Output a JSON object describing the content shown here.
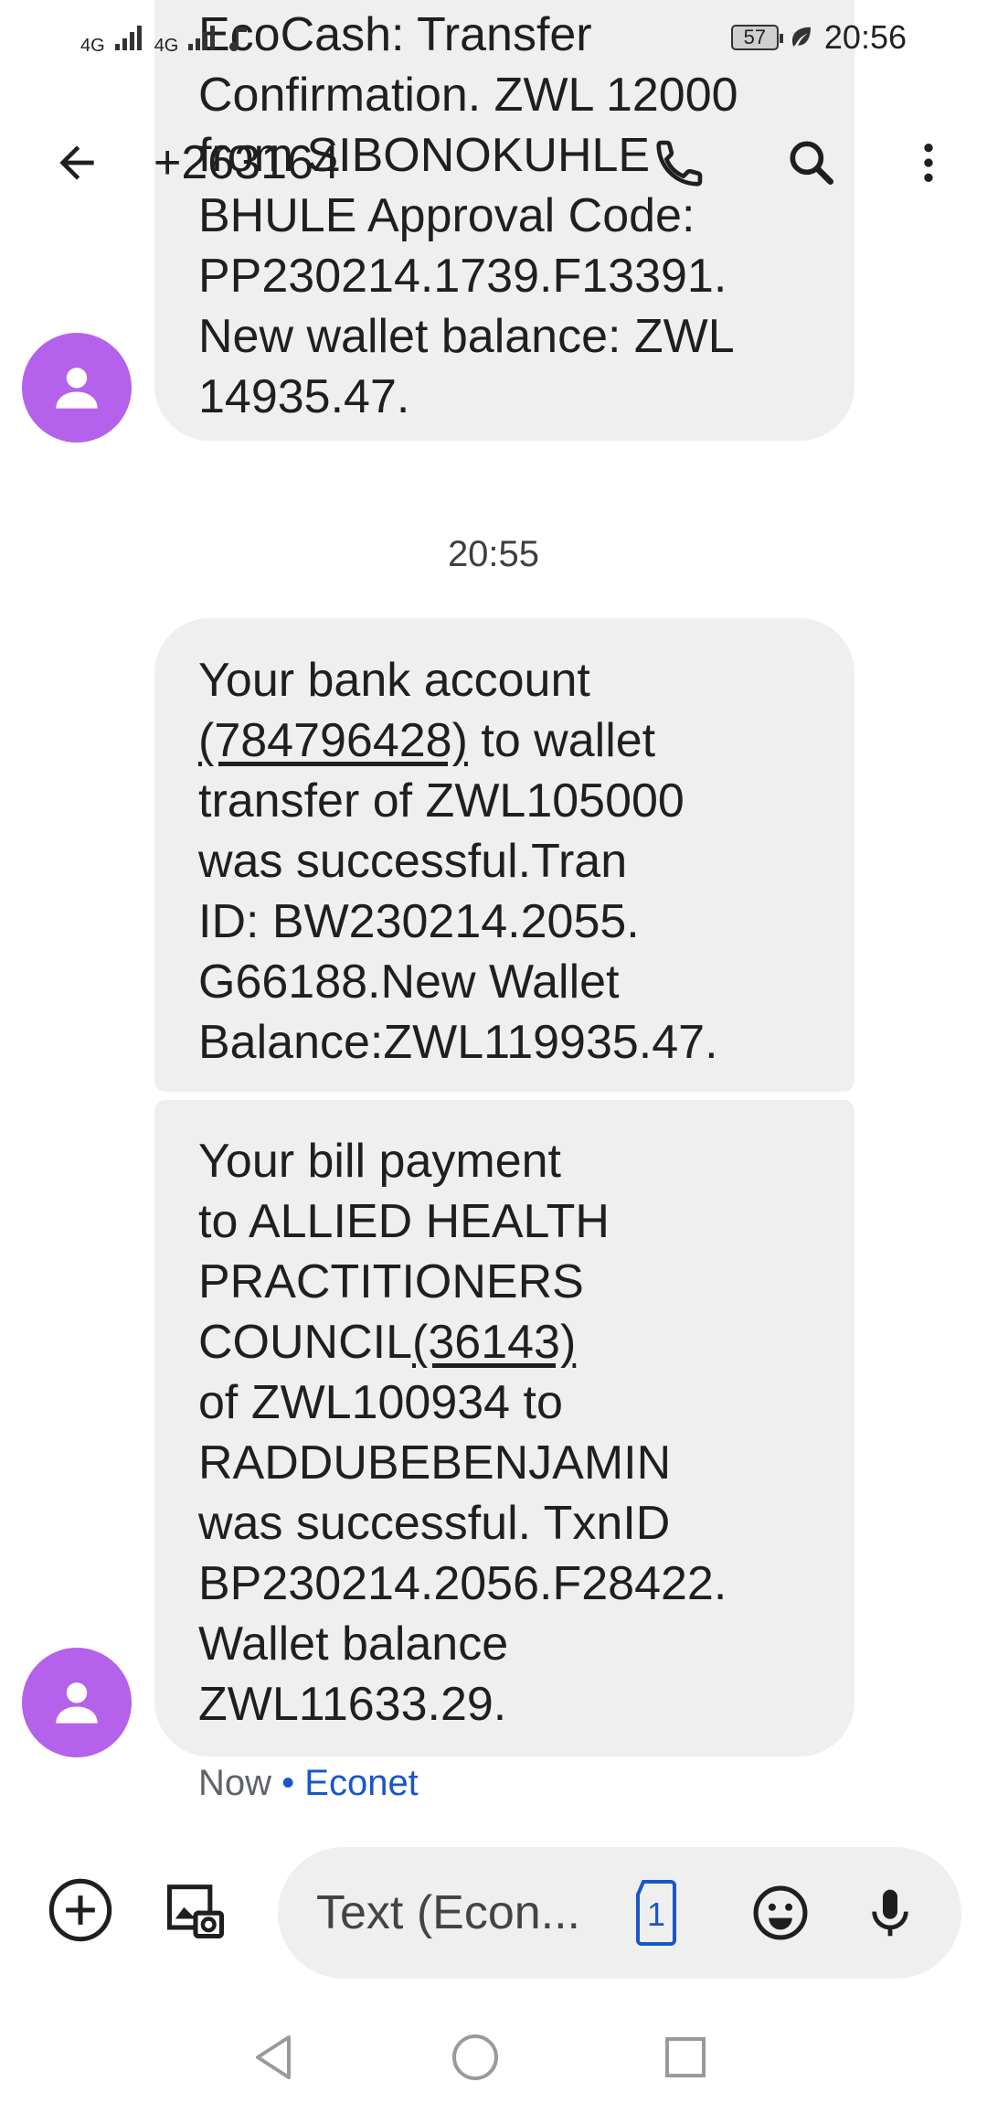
{
  "status_bar": {
    "signal_1": "4G",
    "signal_2": "4G",
    "battery": "57",
    "time": "20:56"
  },
  "app_bar": {
    "title": "+263164"
  },
  "messages": [
    {
      "lines": [
        "EcoCash: Transfer",
        "Confirmation. ZWL 12000",
        "from SIBONOKUHLE",
        "BHULE Approval Code:",
        "PP230214.1739.F13391.",
        "New wallet balance: ZWL",
        "14935.47."
      ]
    },
    {
      "part_1": "Your bank account\n",
      "account": "(784796428)",
      "part_2": " to wallet\ntransfer of ZWL105000\nwas successful.Tran\nID: BW230214.2055.\nG66188.New Wallet\nBalance:ZWL119935.47."
    },
    {
      "part_1": "Your bill payment\nto ALLIED HEALTH\nPRACTITIONERS\nCOUNCIL",
      "code": "(36143)",
      "part_2": "\nof ZWL100934 to\nRADDUBEBENJAMIN\nwas successful. TxnID\nBP230214.2056.F28422.\nWallet balance\nZWL11633.29."
    }
  ],
  "timestamp": "20:55",
  "last_message_meta": {
    "time": "Now",
    "separator": " • ",
    "carrier": "Econet"
  },
  "compose": {
    "placeholder": "Text (Econ...",
    "sim_slot": "1"
  },
  "colors": {
    "avatar": "#b462ec",
    "bubble": "#efefef",
    "accent": "#1a56c8"
  },
  "icons": {
    "back": "arrow-left-icon",
    "call": "phone-icon",
    "search": "search-icon",
    "more": "more-vert-icon",
    "add": "add-circle-icon",
    "gallery": "gallery-icon",
    "emoji": "emoji-icon",
    "mic": "mic-icon"
  }
}
